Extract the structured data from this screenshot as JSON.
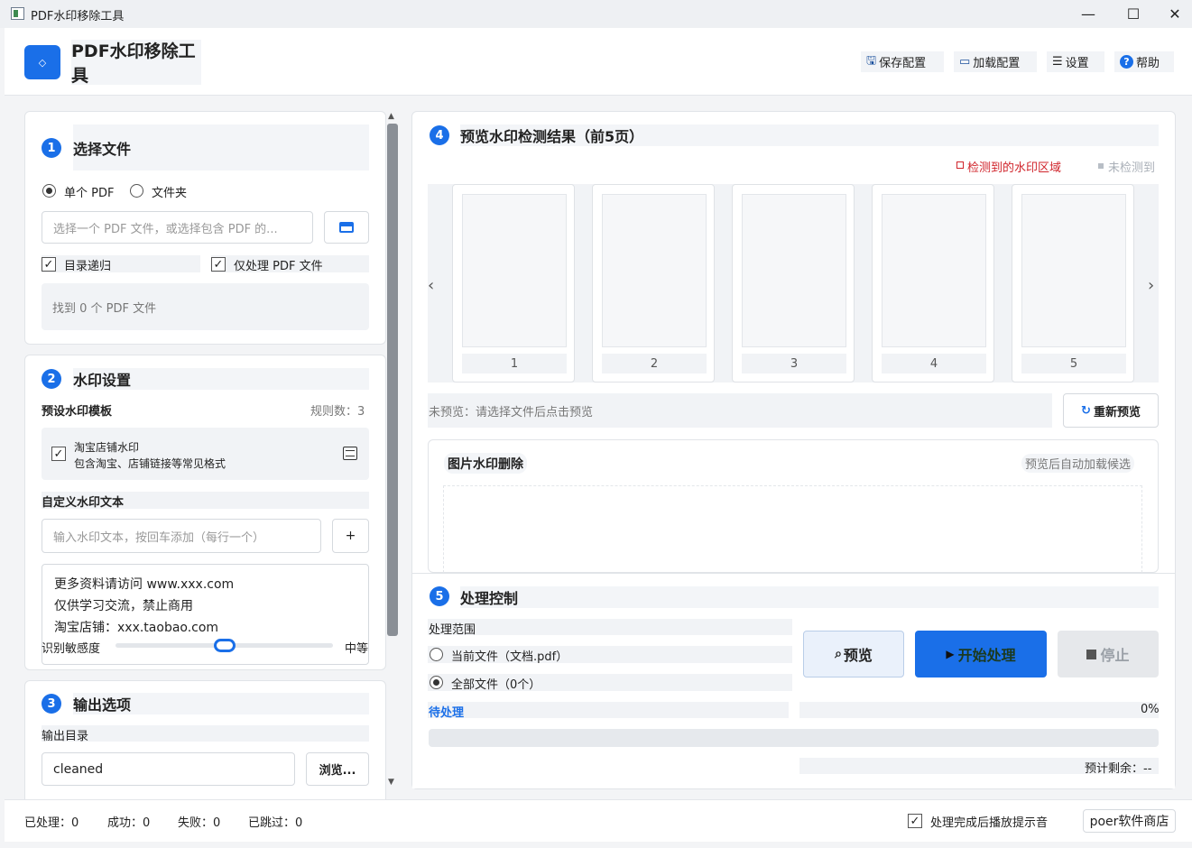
{
  "window": {
    "title": "PDF水印移除工具",
    "minimize": "—",
    "maximize": "☐",
    "close": "✕"
  },
  "header": {
    "logo_icon": "◇",
    "app_title": "PDF水印移除工具",
    "buttons": [
      {
        "icon": "save-icon",
        "glyph": "🖫",
        "label": "保存配置"
      },
      {
        "icon": "folder-icon",
        "glyph": "▭",
        "label": "加载配置"
      },
      {
        "icon": "settings-icon",
        "glyph": "☰",
        "label": "设置"
      },
      {
        "icon": "help-icon",
        "glyph": "?",
        "label": "帮助"
      }
    ]
  },
  "file_section": {
    "step": "1",
    "title": "选择文件",
    "radio_single": "单个 PDF",
    "radio_folder": "文件夹",
    "selected": "single",
    "path_placeholder": "选择一个 PDF 文件，或选择包含 PDF 的...",
    "browse_icon": "folder-icon",
    "recursive_label": "目录递归",
    "recursive_checked": true,
    "pdf_only_label": "仅处理 PDF 文件",
    "pdf_only_checked": true,
    "found_text": "找到 0 个 PDF 文件"
  },
  "watermark_section": {
    "step": "2",
    "title": "水印设置",
    "preset_label": "预设水印模板",
    "rule_count": "规则数：3",
    "template_name": "淘宝店铺水印",
    "template_desc": "包含淘宝、店铺链接等常见格式",
    "template_checked": true,
    "custom_label": "自定义水印文本",
    "custom_placeholder": "输入水印文本，按回车添加（每行一个）",
    "add_label": "+",
    "items": [
      "更多资料请访问 www.xxx.com",
      "仅供学习交流，禁止商用",
      "淘宝店铺：xxx.taobao.com"
    ],
    "sensitivity_label": "识别敏感度",
    "sensitivity_value": "中等",
    "sensitivity_level": 0.5
  },
  "output_section": {
    "step": "3",
    "title": "输出选项",
    "dir_label": "输出目录",
    "dir_value": "cleaned",
    "browse_label": "浏览..."
  },
  "preview_section": {
    "step": "4",
    "title": "预览水印检测结果（前5页）",
    "legend_detected": "检测到的水印区域",
    "legend_none": "未检测到",
    "detected_color": "#d0242b",
    "pages": [
      "1",
      "2",
      "3",
      "4",
      "5"
    ],
    "status": "未预览：请选择文件后点击预览",
    "refresh_label": "重新预览",
    "image_wm_title": "图片水印删除",
    "image_wm_hint": "预览后自动加载候选"
  },
  "control_section": {
    "step": "5",
    "title": "处理控制",
    "range_label": "处理范围",
    "opt_current": "当前文件（文档.pdf）",
    "opt_all": "全部文件（0个）",
    "selected": "all",
    "preview_btn": "预览",
    "start_btn": "开始处理",
    "stop_btn": "停止",
    "status": "待处理",
    "percent": "0%",
    "progress": 0,
    "remaining": "预计剩余：--"
  },
  "statusbar": {
    "processed": "已处理：0",
    "success": "成功：0",
    "failed": "失败：0",
    "skipped": "已跳过：0",
    "sound_label": "处理完成后播放提示音",
    "sound_checked": true,
    "shop_label": "poer软件商店"
  },
  "colors": {
    "accent": "#1a6fe8",
    "panel": "#ffffff",
    "background": "#f3f4f6"
  }
}
